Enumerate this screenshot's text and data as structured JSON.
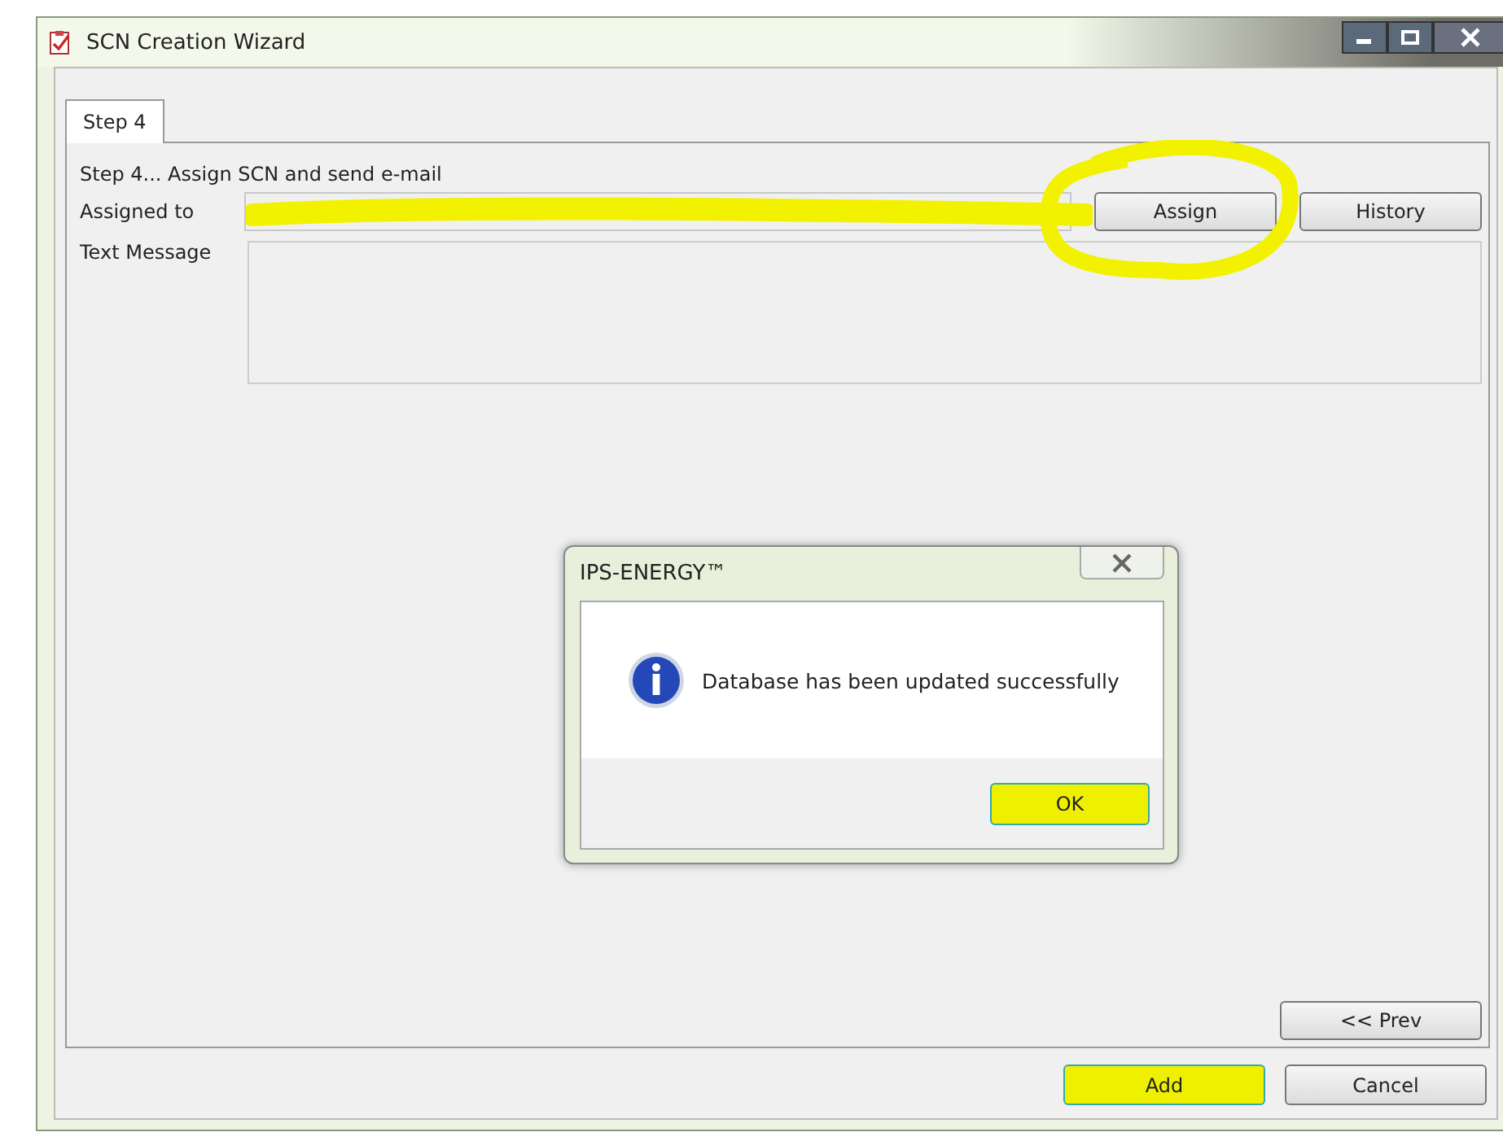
{
  "window": {
    "title": "SCN Creation Wizard"
  },
  "tabs": [
    {
      "label": "Step 4",
      "selected": true
    }
  ],
  "heading": "Step 4... Assign SCN and send e-mail",
  "assigned_to": {
    "label": "Assigned to",
    "redacted": true
  },
  "buttons_top": [
    {
      "label": "Assign",
      "circled": true
    },
    {
      "label": "History",
      "circled": false
    }
  ],
  "text_message": {
    "label": "Text Message"
  },
  "prev_button": {
    "label": "<< Prev"
  },
  "footer_buttons": [
    {
      "label": "Add",
      "highlighted": true
    },
    {
      "label": "Cancel",
      "highlighted": false
    }
  ],
  "dialog": {
    "title": "IPS-ENERGY™",
    "message": "Database has been updated successfully",
    "button": {
      "label": "OK",
      "highlighted": true
    }
  }
}
